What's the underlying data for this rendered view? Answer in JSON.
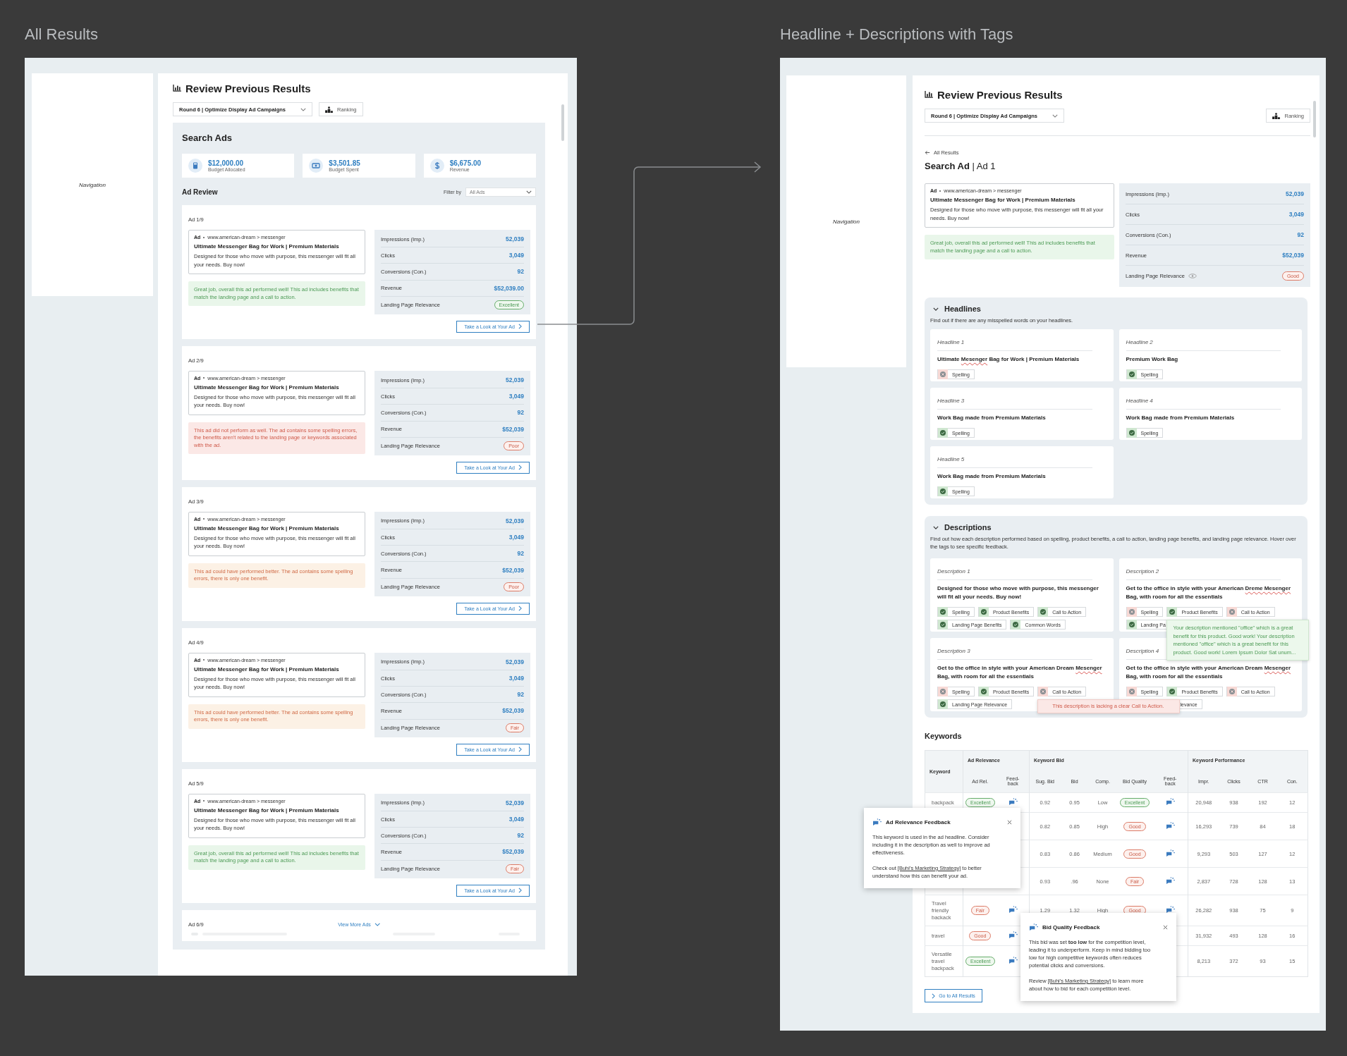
{
  "left_board": {
    "board_title": "All Results",
    "navigation": "Navigation",
    "page_title": "Review Previous Results",
    "round_select": "Round 6 | Optimize Display Ad Campaigns",
    "ranking_button": "Ranking",
    "section_title": "Search Ads",
    "budget_cards": [
      {
        "kind": "calculator",
        "value": "$12,000.00",
        "label": "Budget Allocated"
      },
      {
        "kind": "cash",
        "value": "$3,501.85",
        "label": "Budget Spent"
      },
      {
        "kind": "coin",
        "value": "$6,675.00",
        "label": "Revenue"
      }
    ],
    "ad_review_title": "Ad Review",
    "filter_label": "Filter by",
    "filter_value": "All Ads",
    "ads": [
      {
        "label": "Ad 1/9",
        "ad_tag": "Ad",
        "url": "www.american-dream > messenger",
        "headline": "Ultimate Messenger Bag for Work | Premium Materials",
        "description": "Designed for those who move with purpose, this messenger will fit all your needs. Buy now!",
        "feedback": {
          "kind": "positive",
          "text": "Great job, overall this ad performed well! This ad includes benefits that match the landing page and a call to action."
        },
        "stats": [
          {
            "label": "Impressions (Imp.)",
            "value": "52,039"
          },
          {
            "label": "Clicks",
            "value": "3,049"
          },
          {
            "label": "Conversions (Con.)",
            "value": "92"
          },
          {
            "label": "Revenue",
            "value": "$52,039.00"
          }
        ],
        "relevance": {
          "label": "Landing Page Relevance",
          "rating": "Excellent",
          "kind": "positive"
        },
        "button": "Take a Look at Your Ad"
      },
      {
        "label": "Ad 2/9",
        "ad_tag": "Ad",
        "url": "www.american-dream > messenger",
        "headline": "Ultimate Messenger Bag for Work | Premium Materials",
        "description": "Designed for those who move with purpose, this messenger will fit all your needs. Buy now!",
        "feedback": {
          "kind": "negative",
          "text": "This ad did not perform as well. The ad contains some spelling errors, the benefits aren't related to the landing page or keywords associated with the ad."
        },
        "stats": [
          {
            "label": "Impressions (Imp.)",
            "value": "52,039"
          },
          {
            "label": "Clicks",
            "value": "3,049"
          },
          {
            "label": "Conversions (Con.)",
            "value": "92"
          },
          {
            "label": "Revenue",
            "value": "$52,039"
          }
        ],
        "relevance": {
          "label": "Landing Page Relevance",
          "rating": "Poor",
          "kind": "negative"
        },
        "button": "Take a Look at Your Ad"
      },
      {
        "label": "Ad 3/9",
        "ad_tag": "Ad",
        "url": "www.american-dream > messenger",
        "headline": "Ultimate Messenger Bag for Work | Premium Materials",
        "description": "Designed for those who move with purpose, this messenger will fit all your needs. Buy now!",
        "feedback": {
          "kind": "warning",
          "text": "This ad could have performed better. The ad contains some spelling errors, there is only one benefit."
        },
        "stats": [
          {
            "label": "Impressions (Imp.)",
            "value": "52,039"
          },
          {
            "label": "Clicks",
            "value": "3,049"
          },
          {
            "label": "Conversions (Con.)",
            "value": "92"
          },
          {
            "label": "Revenue",
            "value": "$52,039"
          }
        ],
        "relevance": {
          "label": "Landing Page Relevance",
          "rating": "Poor",
          "kind": "negative"
        },
        "button": "Take a Look at Your Ad"
      },
      {
        "label": "Ad 4/9",
        "ad_tag": "Ad",
        "url": "www.american-dream > messenger",
        "headline": "Ultimate Messenger Bag for Work | Premium Materials",
        "description": "Designed for those who move with purpose, this messenger will fit all your needs. Buy now!",
        "feedback": {
          "kind": "warning",
          "text": "This ad could have performed better. The ad contains some spelling errors, there is only one benefit."
        },
        "stats": [
          {
            "label": "Impressions (Imp.)",
            "value": "52,039"
          },
          {
            "label": "Clicks",
            "value": "3,049"
          },
          {
            "label": "Conversions (Con.)",
            "value": "92"
          },
          {
            "label": "Revenue",
            "value": "$52,039"
          }
        ],
        "relevance": {
          "label": "Landing Page Relevance",
          "rating": "Fair",
          "kind": "negative"
        },
        "button": "Take a Look at Your Ad"
      },
      {
        "label": "Ad 5/9",
        "ad_tag": "Ad",
        "url": "www.american-dream > messenger",
        "headline": "Ultimate Messenger Bag for Work | Premium Materials",
        "description": "Designed for those who move with purpose, this messenger will fit all your needs. Buy now!",
        "feedback": {
          "kind": "positive",
          "text": "Great job, overall this ad performed well! This ad includes benefits that match the landing page and a call to action."
        },
        "stats": [
          {
            "label": "Impressions (Imp.)",
            "value": "52,039"
          },
          {
            "label": "Clicks",
            "value": "3,049"
          },
          {
            "label": "Conversions (Con.)",
            "value": "92"
          },
          {
            "label": "Revenue",
            "value": "$52,039"
          }
        ],
        "relevance": {
          "label": "Landing Page Relevance",
          "rating": "Fair",
          "kind": "negative"
        },
        "button": "Take a Look at Your Ad"
      }
    ],
    "next_ad": {
      "label": "Ad 6/9",
      "view_more": "View More Ads"
    }
  },
  "right_board": {
    "board_title": "Headline + Descriptions with Tags",
    "navigation": "Navigation",
    "page_title": "Review Previous Results",
    "round_select": "Round 6 | Optimize Display Ad Campaigns",
    "ranking_button": "Ranking",
    "back_link": "All Results",
    "ad_title": "**Search Ad** | Ad 1",
    "ad": {
      "ad_tag": "Ad",
      "url": "www.american-dream > messenger",
      "headline": "Ultimate Messenger Bag for Work | Premium Materials",
      "description": "Designed for those who move with purpose, this messenger will fit all your needs. Buy now!",
      "feedback": {
        "kind": "positive",
        "text": "Great job, overall this ad performed well! This ad includes benefits that match the landing page and a call to action."
      },
      "stats": [
        {
          "label": "Impressions (Imp.)",
          "value": "52,039"
        },
        {
          "label": "Clicks",
          "value": "3,049"
        },
        {
          "label": "Conversions (Con.)",
          "value": "92"
        },
        {
          "label": "Revenue",
          "value": "$52,039"
        }
      ],
      "relevance": {
        "label": "Landing Page Relevance",
        "rating": "Good",
        "kind": "negative",
        "info_icon": true
      }
    },
    "headlines": {
      "title": "Headlines",
      "expanded": true,
      "hint": "Find out if there are any misspelled words on your headlines.",
      "items": [
        {
          "label": "Headline 1",
          "segments": [
            {
              "text": "Ultimate ",
              "misspelled": false
            },
            {
              "text": "Mesenger",
              "misspelled": true
            },
            {
              "text": " Bag for Work | Premium Materials",
              "misspelled": false
            }
          ],
          "tags": [
            {
              "label": "Spelling",
              "passed": false
            }
          ]
        },
        {
          "label": "Headline 2",
          "segments": [
            {
              "text": "Premium Work Bag",
              "misspelled": false
            }
          ],
          "tags": [
            {
              "label": "Spelling",
              "passed": true
            }
          ]
        },
        {
          "label": "Headline 3",
          "segments": [
            {
              "text": "Work Bag made from Premium Materials",
              "misspelled": false
            }
          ],
          "tags": [
            {
              "label": "Spelling",
              "passed": true
            }
          ]
        },
        {
          "label": "Headline 4",
          "segments": [
            {
              "text": "Work Bag made from Premium Materials",
              "misspelled": false
            }
          ],
          "tags": [
            {
              "label": "Spelling",
              "passed": true
            }
          ]
        },
        {
          "label": "Headline 5",
          "segments": [
            {
              "text": "Work Bag made from Premium Materials",
              "misspelled": false
            }
          ],
          "tags": [
            {
              "label": "Spelling",
              "passed": true
            }
          ]
        }
      ]
    },
    "descriptions": {
      "title": "Descriptions",
      "expanded": true,
      "hint": "Find out how each description performed based on spelling, product benefits, a call to action, landing page benefits, and landing page relevance. Hover over the tags to see specific feedback.",
      "items": [
        {
          "label": "Description 1",
          "segments": [
            {
              "text": "Designed for those who move with purpose, this messenger will fit all your needs. Buy now!",
              "misspelled": false
            }
          ],
          "tag_rows": [
            [
              {
                "label": "Spelling",
                "passed": true
              },
              {
                "label": "Product Benefits",
                "passed": true
              },
              {
                "label": "Call to Action",
                "passed": true
              }
            ],
            [
              {
                "label": "Landing Page Benefits",
                "passed": true
              },
              {
                "label": "Common Words",
                "passed": true
              }
            ]
          ]
        },
        {
          "label": "Description 2",
          "segments": [
            {
              "text": "Get to the office in style with your American ",
              "misspelled": false
            },
            {
              "text": "Dreme Mesenger",
              "misspelled": true
            },
            {
              "text": " Bag, with room for all the essentials",
              "misspelled": false
            }
          ],
          "tag_rows": [
            [
              {
                "label": "Spelling",
                "passed": false
              },
              {
                "label": "Product Benefits",
                "passed": true,
                "tooltip": {
                  "kind": "positive",
                  "text": "Your description mentioned \"office\" which is a great benefit for this product. Good work! Your description mentioned \"office\" which is a great benefit for this product. Good work! Lorem Ipsum Dolor Sat unum..."
                }
              },
              {
                "label": "Call to Action",
                "passed": false
              }
            ],
            [
              {
                "label": "Landing Pa",
                "passed": true
              }
            ]
          ]
        },
        {
          "label": "Description 3",
          "segments": [
            {
              "text": "Get to the office in style with your American Dream ",
              "misspelled": false
            },
            {
              "text": "Mesenger",
              "misspelled": true
            },
            {
              "text": " Bag, with room for all the essentials",
              "misspelled": false
            }
          ],
          "tag_rows": [
            [
              {
                "label": "Spelling",
                "passed": false
              },
              {
                "label": "Product Benefits",
                "passed": true
              },
              {
                "label": "Call to Action",
                "passed": false,
                "tooltip": {
                  "kind": "negative",
                  "text": "This description is lacking a clear Call to Action."
                }
              }
            ],
            [
              {
                "label": "Landing Page Relevance",
                "passed": true
              }
            ]
          ]
        },
        {
          "label": "Description 4",
          "segments": [
            {
              "text": "Get to the office in style with your American Dream ",
              "misspelled": false
            },
            {
              "text": "Mesenger",
              "misspelled": true
            },
            {
              "text": " Bag, with room for all the essentials",
              "misspelled": false
            }
          ],
          "tag_rows": [
            [
              {
                "label": "Spelling",
                "passed": false
              },
              {
                "label": "Product Benefits",
                "passed": true
              },
              {
                "label": "Call to Action",
                "passed": false
              }
            ],
            [
              {
                "label": "levance"
              }
            ]
          ]
        }
      ]
    },
    "keywords": {
      "title": "Keywords",
      "groups": [
        "Keyword",
        "Ad Relevance",
        "Keyword Bid",
        "Keyword Performance"
      ],
      "columns": [
        "Ad Rel.",
        "Feed-back",
        "Sug. Bid",
        "Bid",
        "Comp.",
        "Bid Quality",
        "Feed-back",
        "Impr.",
        "Clicks",
        "CTR",
        "Con."
      ],
      "rows": [
        {
          "keyword": "backpack",
          "ad_rel": {
            "rating": "Excellent",
            "kind": "positive"
          },
          "ad_feedback": true,
          "sug_bid": "0.92",
          "bid": "0.95",
          "comp": "Low",
          "bid_quality": {
            "rating": "Excellent",
            "kind": "positive"
          },
          "bid_feedback": true,
          "impr": "20,948",
          "clicks": "938",
          "ctr": "192",
          "con": "12"
        },
        {
          "sug_bid": "0.82",
          "bid": "0.85",
          "comp": "High",
          "bid_quality": {
            "rating": "Good",
            "kind": "negative"
          },
          "bid_feedback": true,
          "impr": "16,293",
          "clicks": "739",
          "ctr": "84",
          "con": "18"
        },
        {
          "sug_bid": "0.83",
          "bid": "0.86",
          "comp": "Medium",
          "bid_quality": {
            "rating": "Good",
            "kind": "negative"
          },
          "bid_feedback": true,
          "impr": "9,293",
          "clicks": "503",
          "ctr": "127",
          "con": "12"
        },
        {
          "sug_bid": "0.93",
          "bid": ".96",
          "comp": "None",
          "bid_quality": {
            "rating": "Fair",
            "kind": "negative"
          },
          "bid_feedback": true,
          "impr": "2,837",
          "clicks": "728",
          "ctr": "128",
          "con": "13"
        },
        {
          "keyword": "Travel friendly backack",
          "ad_rel": {
            "rating": "Fair",
            "kind": "negative"
          },
          "ad_feedback": true,
          "sug_bid": "1.29",
          "bid": "1.32",
          "comp": "High",
          "bid_quality": {
            "rating": "Good",
            "kind": "negative"
          },
          "bid_feedback": true,
          "impr": "26,282",
          "clicks": "938",
          "ctr": "75",
          "con": "9"
        },
        {
          "keyword": "travel",
          "ad_rel": {
            "rating": "Good",
            "kind": "negative"
          },
          "ad_feedback": true,
          "impr": "31,932",
          "clicks": "493",
          "ctr": "128",
          "con": "16"
        },
        {
          "keyword": "Versatile travel backpack",
          "ad_rel": {
            "rating": "Excellent",
            "kind": "positive"
          },
          "ad_feedback": true,
          "impr": "8,213",
          "clicks": "372",
          "ctr": "93",
          "con": "15"
        }
      ],
      "popovers": [
        {
          "title": "Ad Relevance Feedback",
          "paragraphs": [
            {
              "text": "This keyword is used in the ad headline. Consider including it in the description as well to improve ad effectiveness."
            },
            {
              "before": "Check out ",
              "link": "[Buhi's Marketing Strategy]",
              "after": " to better understand how this can benefit your ad."
            }
          ]
        },
        {
          "title": "Bid Quality Feedback",
          "paragraphs": [
            {
              "text": "This bid was set **too low** for the competition level, leading it to underperform. Keep in mind bidding too low for high competitive keywords often reduces potential clicks and conversions."
            },
            {
              "before": "Review ",
              "link": "[Buhi's Marketing Strategy]",
              "after": " to learn more about how to bid for each competition level."
            }
          ]
        }
      ]
    },
    "back_button": "Go to All Results"
  }
}
